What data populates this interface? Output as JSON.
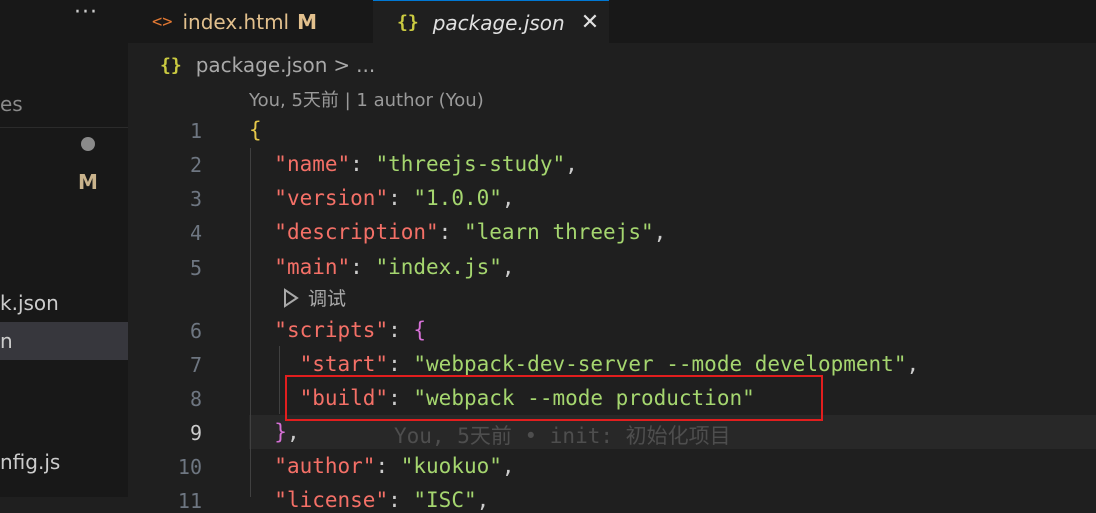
{
  "tabs": {
    "more": "···",
    "tab1": {
      "icon": "html-file-icon",
      "icon_glyph": "<>",
      "label": "index.html",
      "badge": "M"
    },
    "tab2": {
      "icon": "json-file-icon",
      "icon_glyph": "{}",
      "label": "package.json",
      "close_glyph": "✕"
    }
  },
  "breadcrumb": {
    "icon_glyph": "{}",
    "file": "package.json",
    "separator": ">",
    "more": "..."
  },
  "sidebar": {
    "partial_es": "es",
    "badge_m": "M",
    "item_json": "k.json",
    "item_active": "n",
    "item_config": "nfig.js"
  },
  "editor": {
    "blame_header": "You, 5天前 | 1 author (You)",
    "codelens": "调试",
    "inline_blame": "You, 5天前 • init: 初始化项目",
    "line_numbers": [
      "1",
      "2",
      "3",
      "4",
      "5",
      "6",
      "7",
      "8",
      "9",
      "10",
      "11"
    ],
    "active_line": "9",
    "lines": {
      "l1": {
        "brace": "{"
      },
      "l2": {
        "key": "\"name\"",
        "value": "\"threejs-study\""
      },
      "l3": {
        "key": "\"version\"",
        "value": "\"1.0.0\""
      },
      "l4": {
        "key": "\"description\"",
        "value": "\"learn threejs\""
      },
      "l5": {
        "key": "\"main\"",
        "value": "\"index.js\""
      },
      "l6": {
        "key": "\"scripts\"",
        "brace": "{"
      },
      "l7": {
        "key": "\"start\"",
        "value": "\"webpack-dev-server --mode development\""
      },
      "l8": {
        "key": "\"build\"",
        "value": "\"webpack --mode production\""
      },
      "l9": {
        "brace": "}"
      },
      "l10": {
        "key": "\"author\"",
        "value": "\"kuokuo\""
      },
      "l11": {
        "key": "\"license\"",
        "value": "\"ISC\""
      }
    }
  },
  "colors": {
    "key": "#f47067",
    "string": "#a5d66f",
    "highlight_box": "#e21e1e",
    "tab_accent": "#0078d4"
  }
}
